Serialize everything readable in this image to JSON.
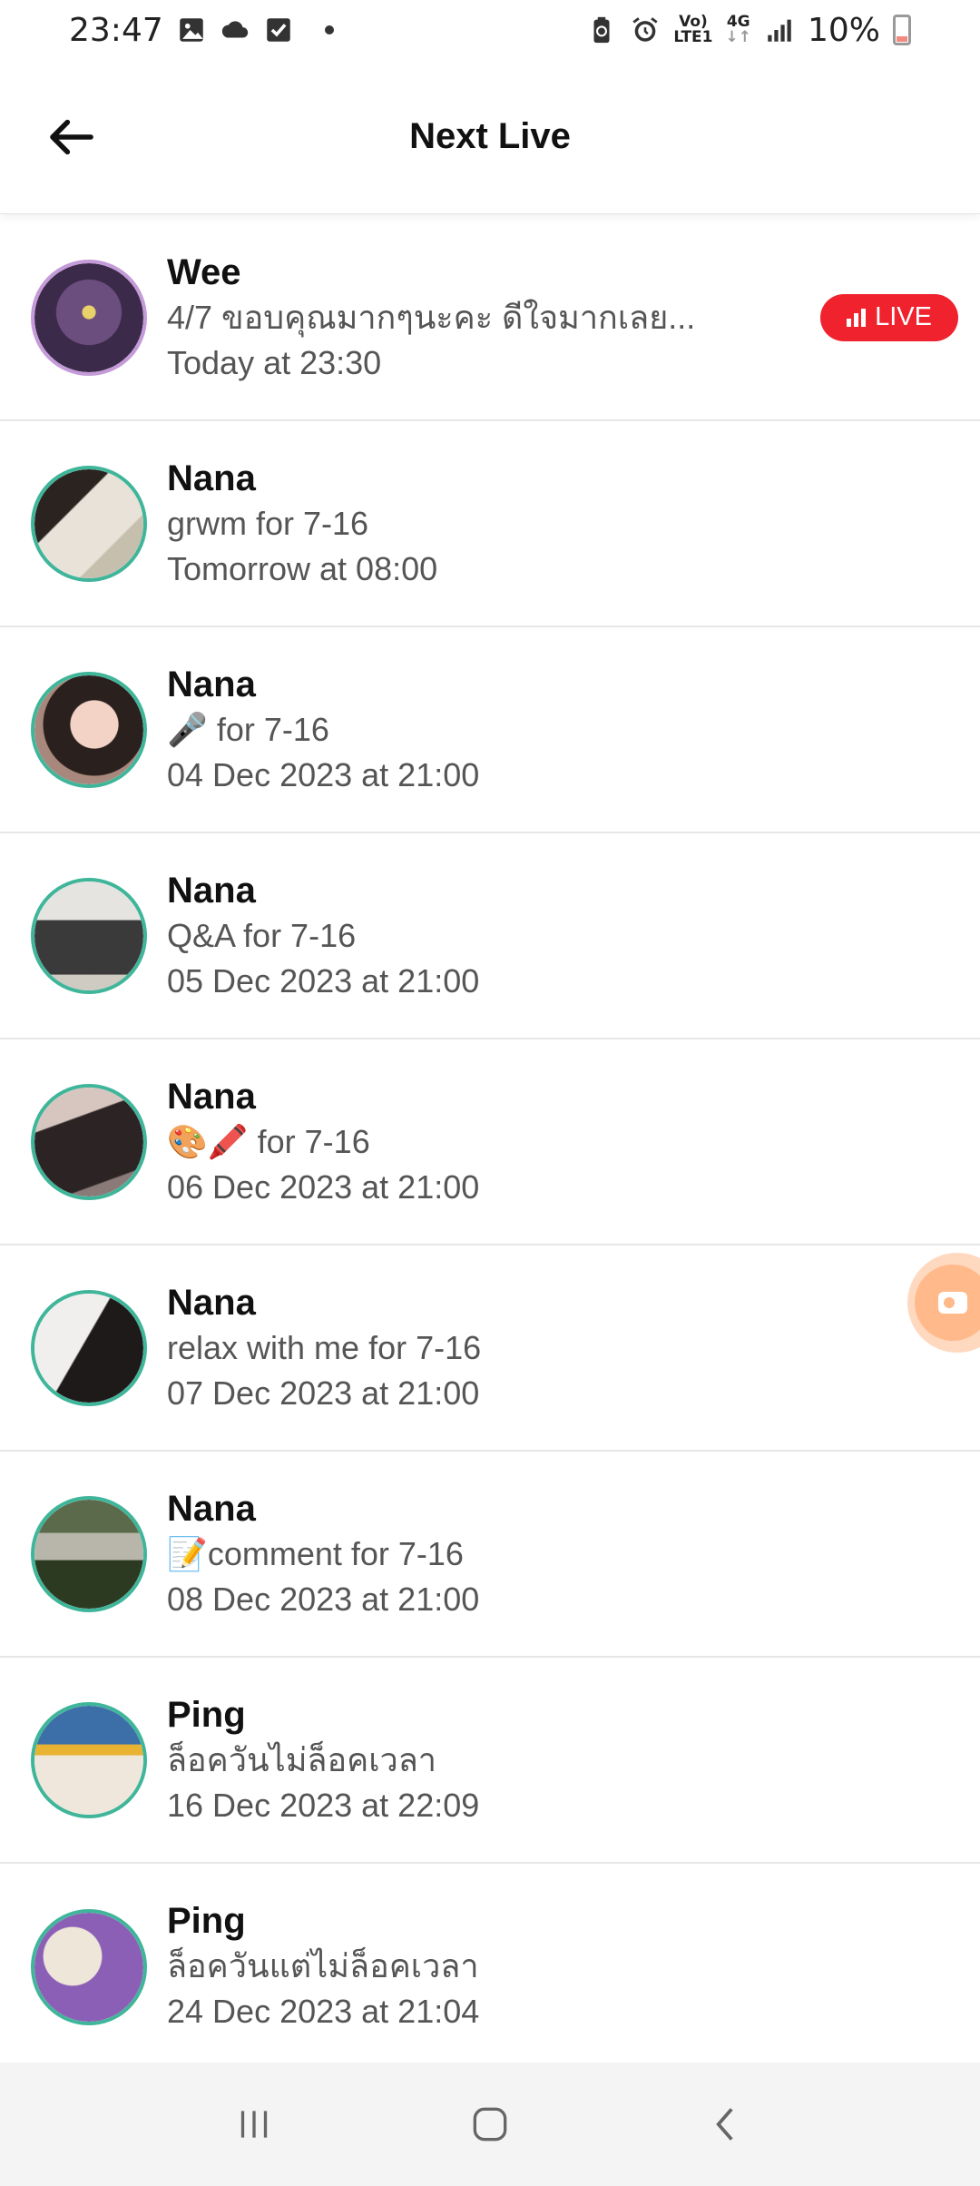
{
  "status_bar": {
    "time": "23:47",
    "left_icons": [
      "image-icon",
      "cloud-icon",
      "check-square-icon",
      "dot-icon"
    ],
    "right_icons": [
      "battery-saver-icon",
      "alarm-icon",
      "volte-icon",
      "4g-icon",
      "signal-icon",
      "battery-icon"
    ],
    "volte_label_top": "Vo)",
    "volte_label_bottom": "LTE1",
    "net_label": "4G",
    "battery_percent": "10%"
  },
  "header": {
    "title": "Next Live",
    "back_icon": "arrow-left-icon"
  },
  "live_badge": {
    "label": "LIVE",
    "color": "#f0222e"
  },
  "items": [
    {
      "name": "Wee",
      "description": "4/7 ขอบคุณมากๆนะคะ ดีใจมากเลย...",
      "time": "Today at 23:30",
      "is_live": true,
      "avatar_color": "#7a5a8a"
    },
    {
      "name": "Nana",
      "description": "grwm for 7-16",
      "time": "Tomorrow at 08:00",
      "is_live": false,
      "avatar_color": "#cfc8bd"
    },
    {
      "name": "Nana",
      "description": "🎤 for 7-16",
      "time": "04 Dec 2023 at 21:00",
      "is_live": false,
      "avatar_color": "#b9a49a"
    },
    {
      "name": "Nana",
      "description": "Q&A for 7-16",
      "time": "05 Dec 2023 at 21:00",
      "is_live": false,
      "avatar_color": "#d8d6d2"
    },
    {
      "name": "Nana",
      "description": "🎨🖍️ for 7-16",
      "time": "06 Dec 2023 at 21:00",
      "is_live": false,
      "avatar_color": "#6a5a5a"
    },
    {
      "name": "Nana",
      "description": "relax with me for 7-16",
      "time": "07 Dec 2023 at 21:00",
      "is_live": false,
      "avatar_color": "#4a4040"
    },
    {
      "name": "Nana",
      "description": "📝comment for 7-16",
      "time": "08 Dec 2023 at 21:00",
      "is_live": false,
      "avatar_color": "#7d8a6a"
    },
    {
      "name": "Ping",
      "description": "ล็อควันไม่ล็อคเวลา",
      "time": "16 Dec 2023 at 22:09",
      "is_live": false,
      "avatar_color": "#5a7fa8"
    },
    {
      "name": "Ping",
      "description": "ล็อควันแต่ไม่ล็อคเวลา",
      "time": "24 Dec 2023 at 21:04",
      "is_live": false,
      "avatar_color": "#a87fc0"
    }
  ],
  "floating_button": {
    "icon": "video-camera-icon",
    "color": "#ffb98a"
  },
  "navbar": {
    "buttons": [
      "recent-apps-icon",
      "home-icon",
      "back-icon"
    ]
  },
  "colors": {
    "avatar_ring": "#3fb59a",
    "divider": "#e6e6e6"
  }
}
